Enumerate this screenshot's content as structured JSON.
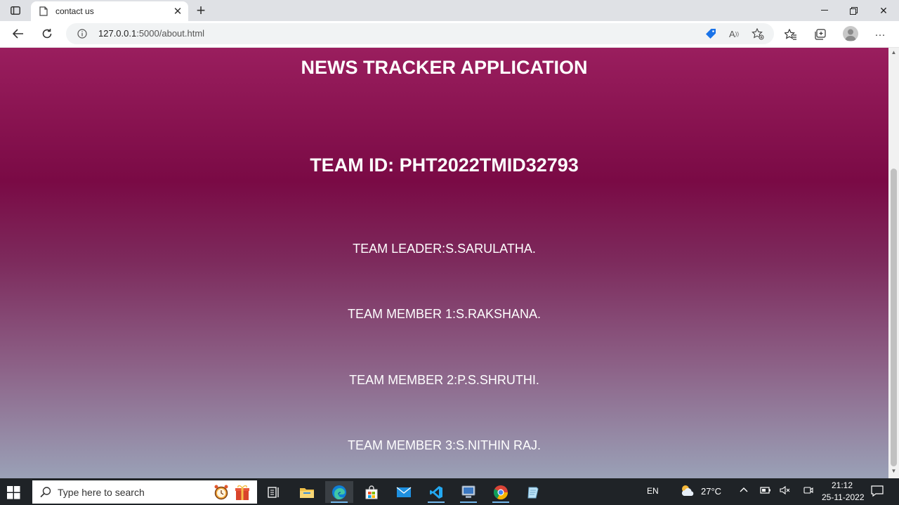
{
  "browser": {
    "tab_title": "contact us",
    "url_host": "127.0.0.1",
    "url_rest": ":5000/about.html"
  },
  "page": {
    "title": "NEWS TRACKER APPLICATION",
    "team_id": "TEAM ID: PHT2022TMID32793",
    "team_leader": "TEAM LEADER:S.SARULATHA.",
    "members": [
      "TEAM MEMBER 1:S.RAKSHANA.",
      "TEAM MEMBER 2:P.S.SHRUTHI.",
      "TEAM MEMBER 3:S.NITHIN RAJ."
    ]
  },
  "taskbar": {
    "search_placeholder": "Type here to search",
    "language": "EN",
    "temperature": "27°C",
    "time": "21:12",
    "date": "25-11-2022"
  },
  "icons": [
    "tab-actions-icon",
    "page-icon",
    "close-icon",
    "plus-icon",
    "minimize-icon",
    "restore-icon",
    "back-icon",
    "refresh-icon",
    "info-icon",
    "tag-icon",
    "read-aloud-icon",
    "add-favorite-icon",
    "favorites-icon",
    "collections-icon",
    "profile-icon",
    "more-icon",
    "windows-icon",
    "search-icon",
    "task-view-icon",
    "file-explorer-icon",
    "edge-icon",
    "store-icon",
    "mail-icon",
    "vscode-icon",
    "chrome-icon",
    "weather-icon",
    "chevron-up-icon",
    "battery-icon",
    "mute-icon",
    "notification-icon"
  ],
  "colors": {
    "page_top": "#9a1e5e",
    "page_mid": "#7a0a45",
    "page_bottom": "#9aa1b7",
    "taskbar": "#1f2327",
    "tag_blue": "#1a73e8"
  }
}
